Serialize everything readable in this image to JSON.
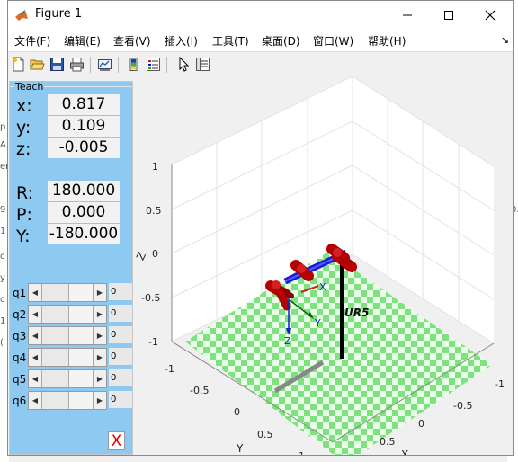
{
  "window": {
    "title": "Figure 1",
    "menu": [
      "文件(F)",
      "编辑(E)",
      "查看(V)",
      "插入(I)",
      "工具(T)",
      "桌面(D)",
      "窗口(W)",
      "帮助(H)"
    ],
    "toolbar_icons": [
      "new-figure-icon",
      "open-file-icon",
      "save-icon",
      "print-icon",
      "link-plot-icon",
      "insert-colorbar-icon",
      "insert-legend-icon",
      "pointer-icon",
      "property-inspector-icon"
    ]
  },
  "teach": {
    "title": "Teach",
    "position": [
      {
        "label": "x:",
        "value": "0.817"
      },
      {
        "label": "y:",
        "value": "0.109"
      },
      {
        "label": "z:",
        "value": "-0.005"
      }
    ],
    "orientation": [
      {
        "label": "R:",
        "value": "180.000"
      },
      {
        "label": "P:",
        "value": "0.000"
      },
      {
        "label": "Y:",
        "value": "-180.000"
      }
    ],
    "joints": [
      {
        "label": "q1",
        "value": "0"
      },
      {
        "label": "q2",
        "value": "0"
      },
      {
        "label": "q3",
        "value": "0"
      },
      {
        "label": "q4",
        "value": "0"
      },
      {
        "label": "q5",
        "value": "0"
      },
      {
        "label": "q6",
        "value": "0"
      }
    ],
    "close_label": "X"
  },
  "plot": {
    "robot_name": "UR5",
    "z_label": "Z",
    "x_label": "X",
    "y_label": "Y",
    "z_ticks": [
      "1",
      "0.5",
      "0",
      "-0.5",
      "-1"
    ],
    "y_ticks": [
      "-1",
      "-0.5",
      "0",
      "0.5",
      "1"
    ],
    "x_ticks": [
      "-1",
      "-0.5",
      "0",
      "0.5"
    ],
    "frame_labels": {
      "x": "X",
      "y": "Y",
      "z": "Z"
    },
    "colors": {
      "links": "#b40000",
      "joint_axes": "#1a1adb",
      "base_pole": "#000000",
      "floor_green": "#7fe27f",
      "floor_light": "#e9ffe9"
    }
  },
  "background_fragments": {
    "left": [
      "p",
      "A",
      "er",
      "9",
      "1",
      "c",
      "y",
      "c",
      "1",
      "("
    ],
    "right": [
      "0.",
      ")"
    ]
  }
}
